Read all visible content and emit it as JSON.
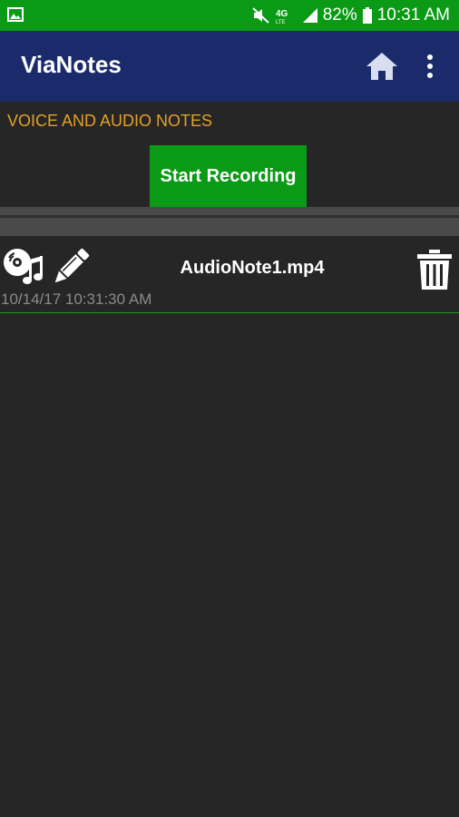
{
  "status_bar": {
    "battery": "82%",
    "time": "10:31 AM",
    "network": "4G LTE"
  },
  "app_bar": {
    "title": "ViaNotes",
    "home_icon": "home-icon",
    "menu_icon": "more-vert-icon"
  },
  "section": {
    "title": "VOICE AND AUDIO NOTES",
    "record_button": "Start Recording"
  },
  "notes": [
    {
      "name": "AudioNote1.mp4",
      "date": "10/14/17 10:31:30 AM",
      "play_icon": "audio-cd-note-icon",
      "edit_icon": "pencil-icon",
      "delete_icon": "trash-icon"
    }
  ],
  "colors": {
    "status_bar": "#0a9a15",
    "app_bar": "#1b2a6b",
    "background": "#262626",
    "accent_orange": "#e2a126",
    "button_green": "#0a9a15"
  }
}
